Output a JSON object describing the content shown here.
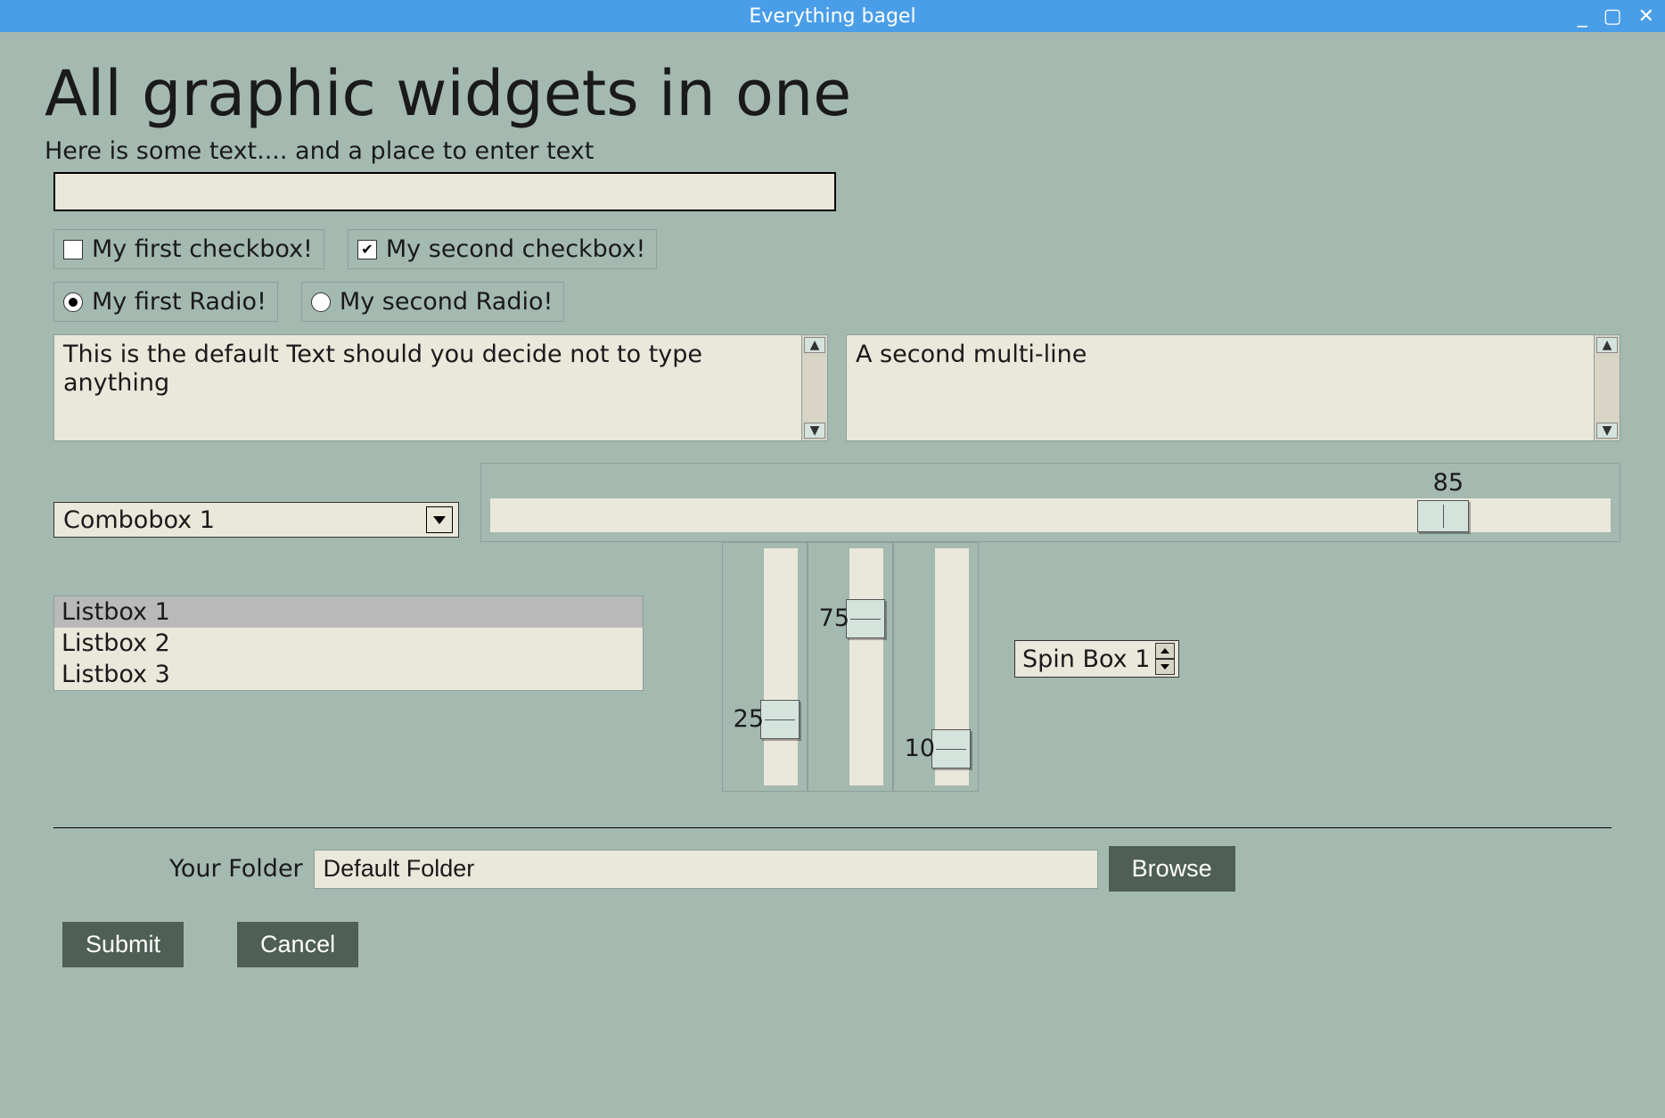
{
  "window": {
    "title": "Everything bagel"
  },
  "heading": "All graphic widgets in one",
  "subtitle": "Here is some text.... and a place to enter text",
  "text_input": {
    "value": ""
  },
  "checkboxes": [
    {
      "label": "My first checkbox!",
      "checked": false
    },
    {
      "label": "My second checkbox!",
      "checked": true
    }
  ],
  "radios": [
    {
      "label": "My first Radio!",
      "selected": true
    },
    {
      "label": "My second Radio!",
      "selected": false
    }
  ],
  "multiline1": "This is the default Text should you decide not to type anything",
  "multiline2": "A second multi-line",
  "combobox": {
    "value": "Combobox 1"
  },
  "hslider": {
    "value": 85,
    "min": 0,
    "max": 100
  },
  "listbox": {
    "items": [
      "Listbox 1",
      "Listbox 2",
      "Listbox 3"
    ],
    "selected_index": 0
  },
  "vsliders": [
    {
      "value": 25,
      "min": 0,
      "max": 100
    },
    {
      "value": 75,
      "min": 0,
      "max": 100
    },
    {
      "value": 10,
      "min": 0,
      "max": 100
    }
  ],
  "spinbox": {
    "value": "Spin Box 1"
  },
  "folder": {
    "label": "Your Folder",
    "value": "Default Folder",
    "browse": "Browse"
  },
  "buttons": {
    "submit": "Submit",
    "cancel": "Cancel"
  },
  "colors": {
    "titlebar": "#4a9ee8",
    "background": "#a4b9b0",
    "field": "#eae7db",
    "button": "#4f5f55"
  }
}
